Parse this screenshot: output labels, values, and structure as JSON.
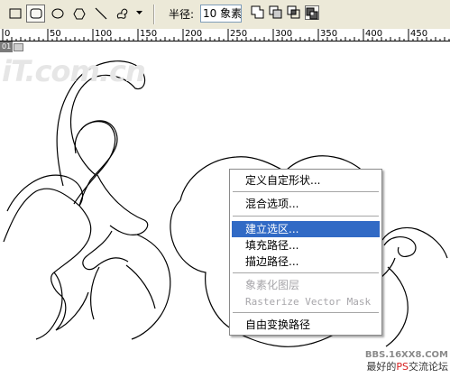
{
  "toolbar": {
    "tools": [
      {
        "name": "rectangle-tool",
        "icon": "rectangle-icon"
      },
      {
        "name": "rounded-rectangle-tool",
        "icon": "rounded-rectangle-icon"
      },
      {
        "name": "ellipse-tool",
        "icon": "ellipse-icon"
      },
      {
        "name": "polygon-tool",
        "icon": "polygon-icon"
      },
      {
        "name": "line-tool",
        "icon": "line-icon"
      },
      {
        "name": "custom-shape-tool",
        "icon": "custom-shape-icon"
      }
    ],
    "radius_label": "半径:",
    "radius_value": "10 象素",
    "path_modes": [
      "add-to-path-area-icon",
      "subtract-from-path-area-icon",
      "intersect-path-areas-icon",
      "exclude-overlapping-path-areas-icon"
    ]
  },
  "ruler": {
    "labels": [
      "0",
      "50",
      "100",
      "150",
      "200",
      "250",
      "300",
      "350",
      "400",
      "450"
    ]
  },
  "document": {
    "tab_number": "01",
    "watermark": "iT.com.cn"
  },
  "context_menu": {
    "items": [
      {
        "label": "定义自定形状...",
        "state": "normal"
      },
      {
        "label": "混合选项...",
        "state": "normal"
      },
      {
        "label": "建立选区...",
        "state": "highlighted"
      },
      {
        "label": "填充路径...",
        "state": "normal"
      },
      {
        "label": "描边路径...",
        "state": "normal"
      },
      {
        "label": "象素化图层",
        "state": "disabled"
      },
      {
        "label": "Rasterize Vector Mask",
        "state": "disabled"
      },
      {
        "label": "自由变换路径",
        "state": "normal"
      }
    ]
  },
  "watermark": {
    "site": "BBS.16XX8.COM",
    "caption_prefix": "最好的",
    "caption_highlight": "PS",
    "caption_suffix": "交流论坛"
  },
  "colors": {
    "toolbar_bg": "#ece9d8",
    "menu_highlight": "#316ac5",
    "disabled_text": "#a7a6aa"
  }
}
